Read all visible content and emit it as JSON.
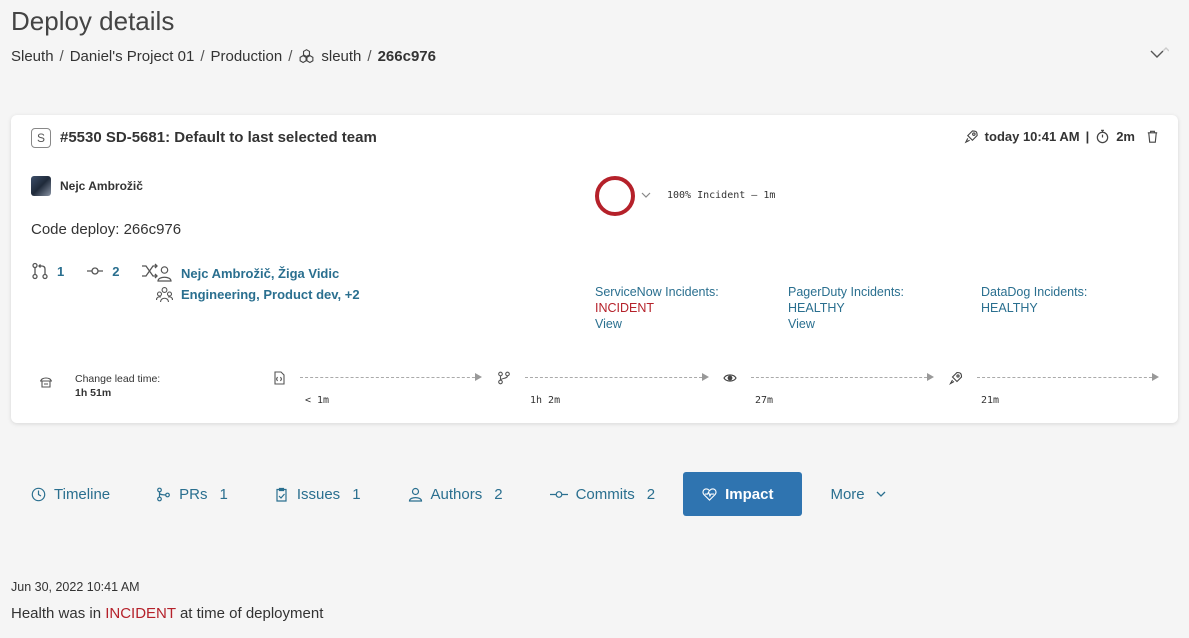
{
  "page": {
    "title": "Deploy details"
  },
  "breadcrumb": {
    "org": "Sleuth",
    "project": "Daniel's Project 01",
    "environment": "Production",
    "repo": "sleuth",
    "sha": "266c976",
    "separator": "/"
  },
  "deploy": {
    "badge": "S",
    "title": "#5530 SD-5681: Default to last selected team",
    "time": "today 10:41 AM",
    "meta_separator": "|",
    "duration": "2m",
    "author": "Nejc Ambrožič",
    "code_deploy": "Code deploy: 266c976",
    "pr_count": "1",
    "commit_count": "2",
    "authors": "Nejc Ambrožič, Žiga Vidic",
    "teams": "Engineering, Product dev, +2",
    "health": {
      "label": "100% Incident – 1m",
      "color": "#b5212a"
    },
    "incidents": [
      {
        "name": "ServiceNow Incidents:",
        "status": "INCIDENT",
        "view": "View"
      },
      {
        "name": "PagerDuty Incidents:",
        "status": "HEALTHY",
        "view": "View"
      },
      {
        "name": "DataDog Incidents:",
        "status": "HEALTHY",
        "view": ""
      }
    ],
    "lead_time": {
      "label": "Change lead time:",
      "value": "1h 51m"
    },
    "stages": [
      {
        "icon": "code-file-icon",
        "duration": "< 1m"
      },
      {
        "icon": "git-branch-icon",
        "duration": "1h 2m"
      },
      {
        "icon": "eye-icon",
        "duration": "27m"
      },
      {
        "icon": "rocket-icon",
        "duration": "21m"
      }
    ]
  },
  "tabs": [
    {
      "label": "Timeline",
      "count": "",
      "icon": "clock-icon"
    },
    {
      "label": "PRs",
      "count": "1",
      "icon": "pull-request-icon"
    },
    {
      "label": "Issues",
      "count": "1",
      "icon": "clipboard-icon"
    },
    {
      "label": "Authors",
      "count": "2",
      "icon": "user-icon"
    },
    {
      "label": "Commits",
      "count": "2",
      "icon": "commit-icon"
    },
    {
      "label": "Impact",
      "count": "",
      "icon": "heart-pulse-icon",
      "active": true
    },
    {
      "label": "More",
      "count": "",
      "icon": "chevron-down-icon"
    }
  ],
  "history": {
    "date": "Jun 30, 2022 10:41 AM",
    "prefix": "Health was in",
    "status": "INCIDENT",
    "suffix": "at time of deployment"
  },
  "colors": {
    "accent": "#2a6f8f",
    "active_tab": "#2f74b0",
    "incident": "#b5212a"
  }
}
